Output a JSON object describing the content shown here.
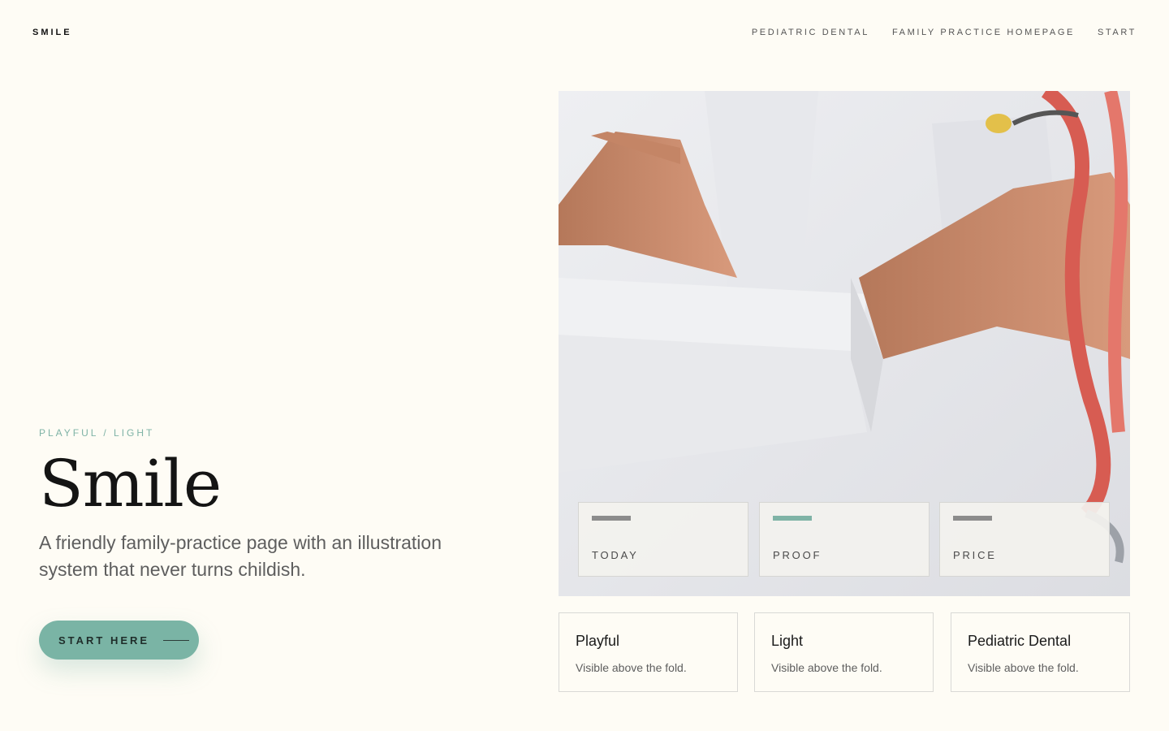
{
  "brand": "SMILE",
  "nav": {
    "items": [
      "PEDIATRIC DENTAL",
      "FAMILY PRACTICE HOMEPAGE",
      "START"
    ]
  },
  "hero": {
    "eyebrow": "PLAYFUL / LIGHT",
    "title": "Smile",
    "subtitle": "A friendly family-practice page with an illustration system that never turns childish.",
    "cta_label": "START HERE"
  },
  "stats": [
    {
      "label": "TODAY",
      "accent": false
    },
    {
      "label": "PROOF",
      "accent": true
    },
    {
      "label": "PRICE",
      "accent": false
    }
  ],
  "features": [
    {
      "title": "Playful",
      "desc": "Visible above the fold."
    },
    {
      "title": "Light",
      "desc": "Visible above the fold."
    },
    {
      "title": "Pediatric Dental",
      "desc": "Visible above the fold."
    }
  ],
  "colors": {
    "background": "#fefcf5",
    "accent": "#7ab4a5",
    "eyebrow": "#7fb3a6"
  }
}
